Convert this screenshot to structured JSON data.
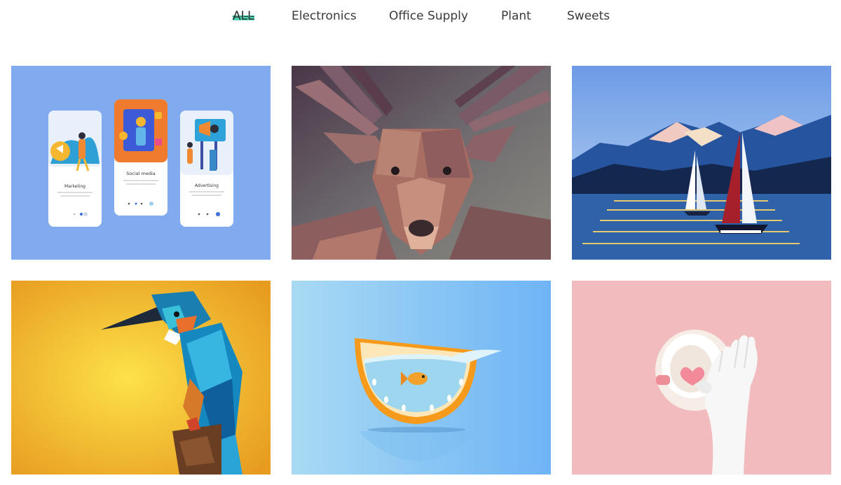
{
  "filters": {
    "items": [
      {
        "label": "ALL",
        "active": true
      },
      {
        "label": "Electronics",
        "active": false
      },
      {
        "label": "Office Supply",
        "active": false
      },
      {
        "label": "Plant",
        "active": false
      },
      {
        "label": "Sweets",
        "active": false
      }
    ]
  },
  "accent_color": "#4dd0b0",
  "gallery": [
    {
      "name": "mobile-app-onboarding",
      "screens": [
        "Marketing",
        "Social media",
        "Advertising"
      ],
      "bg": "#82abef"
    },
    {
      "name": "lowpoly-deer",
      "bg": "#6d6b6e"
    },
    {
      "name": "sailboats-mountains",
      "bg": "#2b5fa6"
    },
    {
      "name": "lowpoly-kingfisher",
      "bg": "#f0b42c"
    },
    {
      "name": "goldfish-orange-bowl",
      "bg": "#8cc8f4"
    },
    {
      "name": "hand-cup-heart",
      "bg": "#f2bcbf"
    }
  ]
}
